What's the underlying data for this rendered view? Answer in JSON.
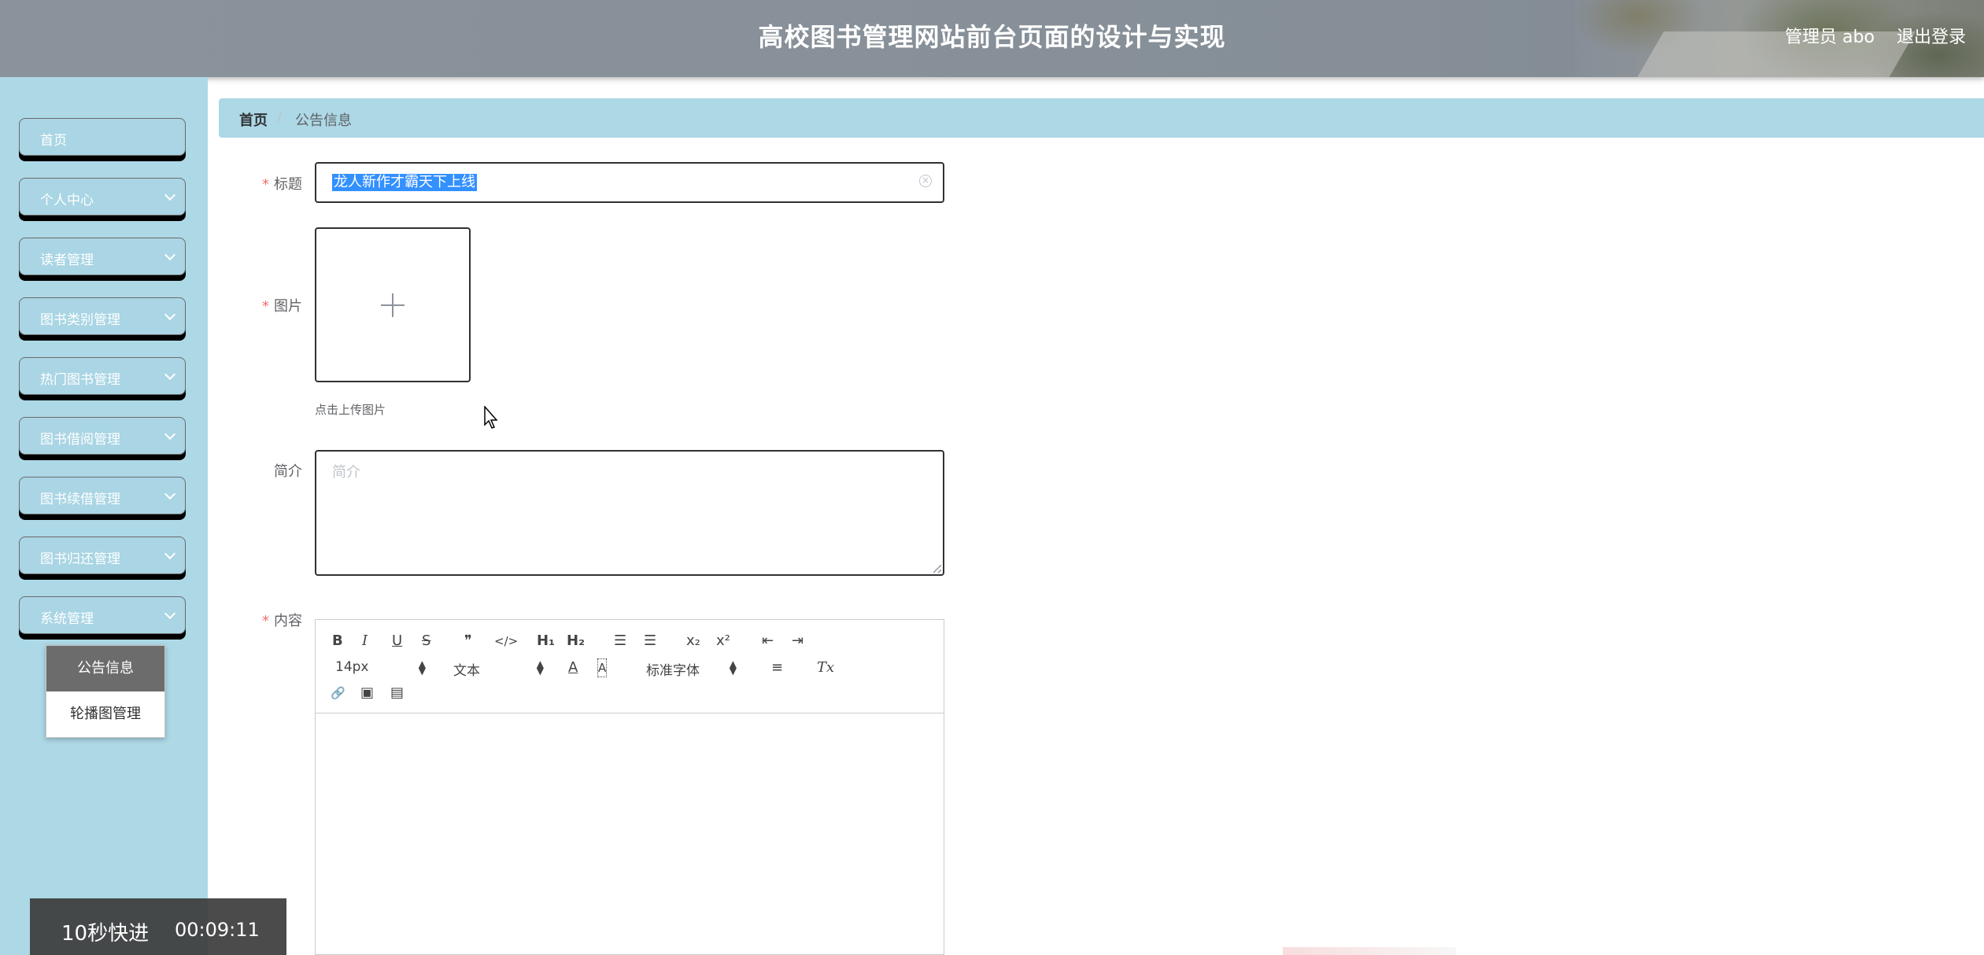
{
  "header": {
    "title": "高校图书管理网站前台页面的设计与实现",
    "admin_label": "管理员 abo",
    "logout_label": "退出登录"
  },
  "sidebar": {
    "items": [
      {
        "label": "首页",
        "has_submenu": false
      },
      {
        "label": "个人中心",
        "has_submenu": true
      },
      {
        "label": "读者管理",
        "has_submenu": true
      },
      {
        "label": "图书类别管理",
        "has_submenu": true
      },
      {
        "label": "热门图书管理",
        "has_submenu": true
      },
      {
        "label": "图书借阅管理",
        "has_submenu": true
      },
      {
        "label": "图书续借管理",
        "has_submenu": true
      },
      {
        "label": "图书归还管理",
        "has_submenu": true
      },
      {
        "label": "系统管理",
        "has_submenu": true
      }
    ],
    "submenu": [
      {
        "label": "公告信息",
        "active": true
      },
      {
        "label": "轮播图管理",
        "active": false
      }
    ]
  },
  "breadcrumb": {
    "home": "首页",
    "separator": "/",
    "current": "公告信息"
  },
  "form": {
    "required_mark": "*",
    "title_label": "标题",
    "title_value": "龙人新作才霸天下上线",
    "image_label": "图片",
    "upload_tip": "点击上传图片",
    "intro_label": "简介",
    "intro_placeholder": "简介",
    "content_label": "内容"
  },
  "editor": {
    "toolbar": {
      "bold": "B",
      "italic": "I",
      "underline": "U",
      "strike": "S",
      "blockquote": "❞",
      "code": "</>",
      "h1": "H₁",
      "h2": "H₂",
      "ordered_list": "☰",
      "bullet_list": "☰",
      "subscript": "x₂",
      "superscript": "x²",
      "outdent": "⇤",
      "indent": "⇥",
      "size": "14px",
      "header_picker": "文本",
      "color": "A",
      "background": "A",
      "font_picker": "标准字体",
      "align": "≡",
      "clean": "Tx",
      "link": "🔗",
      "image": "▣",
      "video": "▤"
    }
  },
  "video_overlay": {
    "fast_forward": "10秒快进",
    "time": "00:09:11"
  },
  "colors": {
    "sidebar_bg": "#add8e6",
    "header_bg": "#868f98",
    "required": "#f56c6c",
    "selection": "#3390ff"
  }
}
